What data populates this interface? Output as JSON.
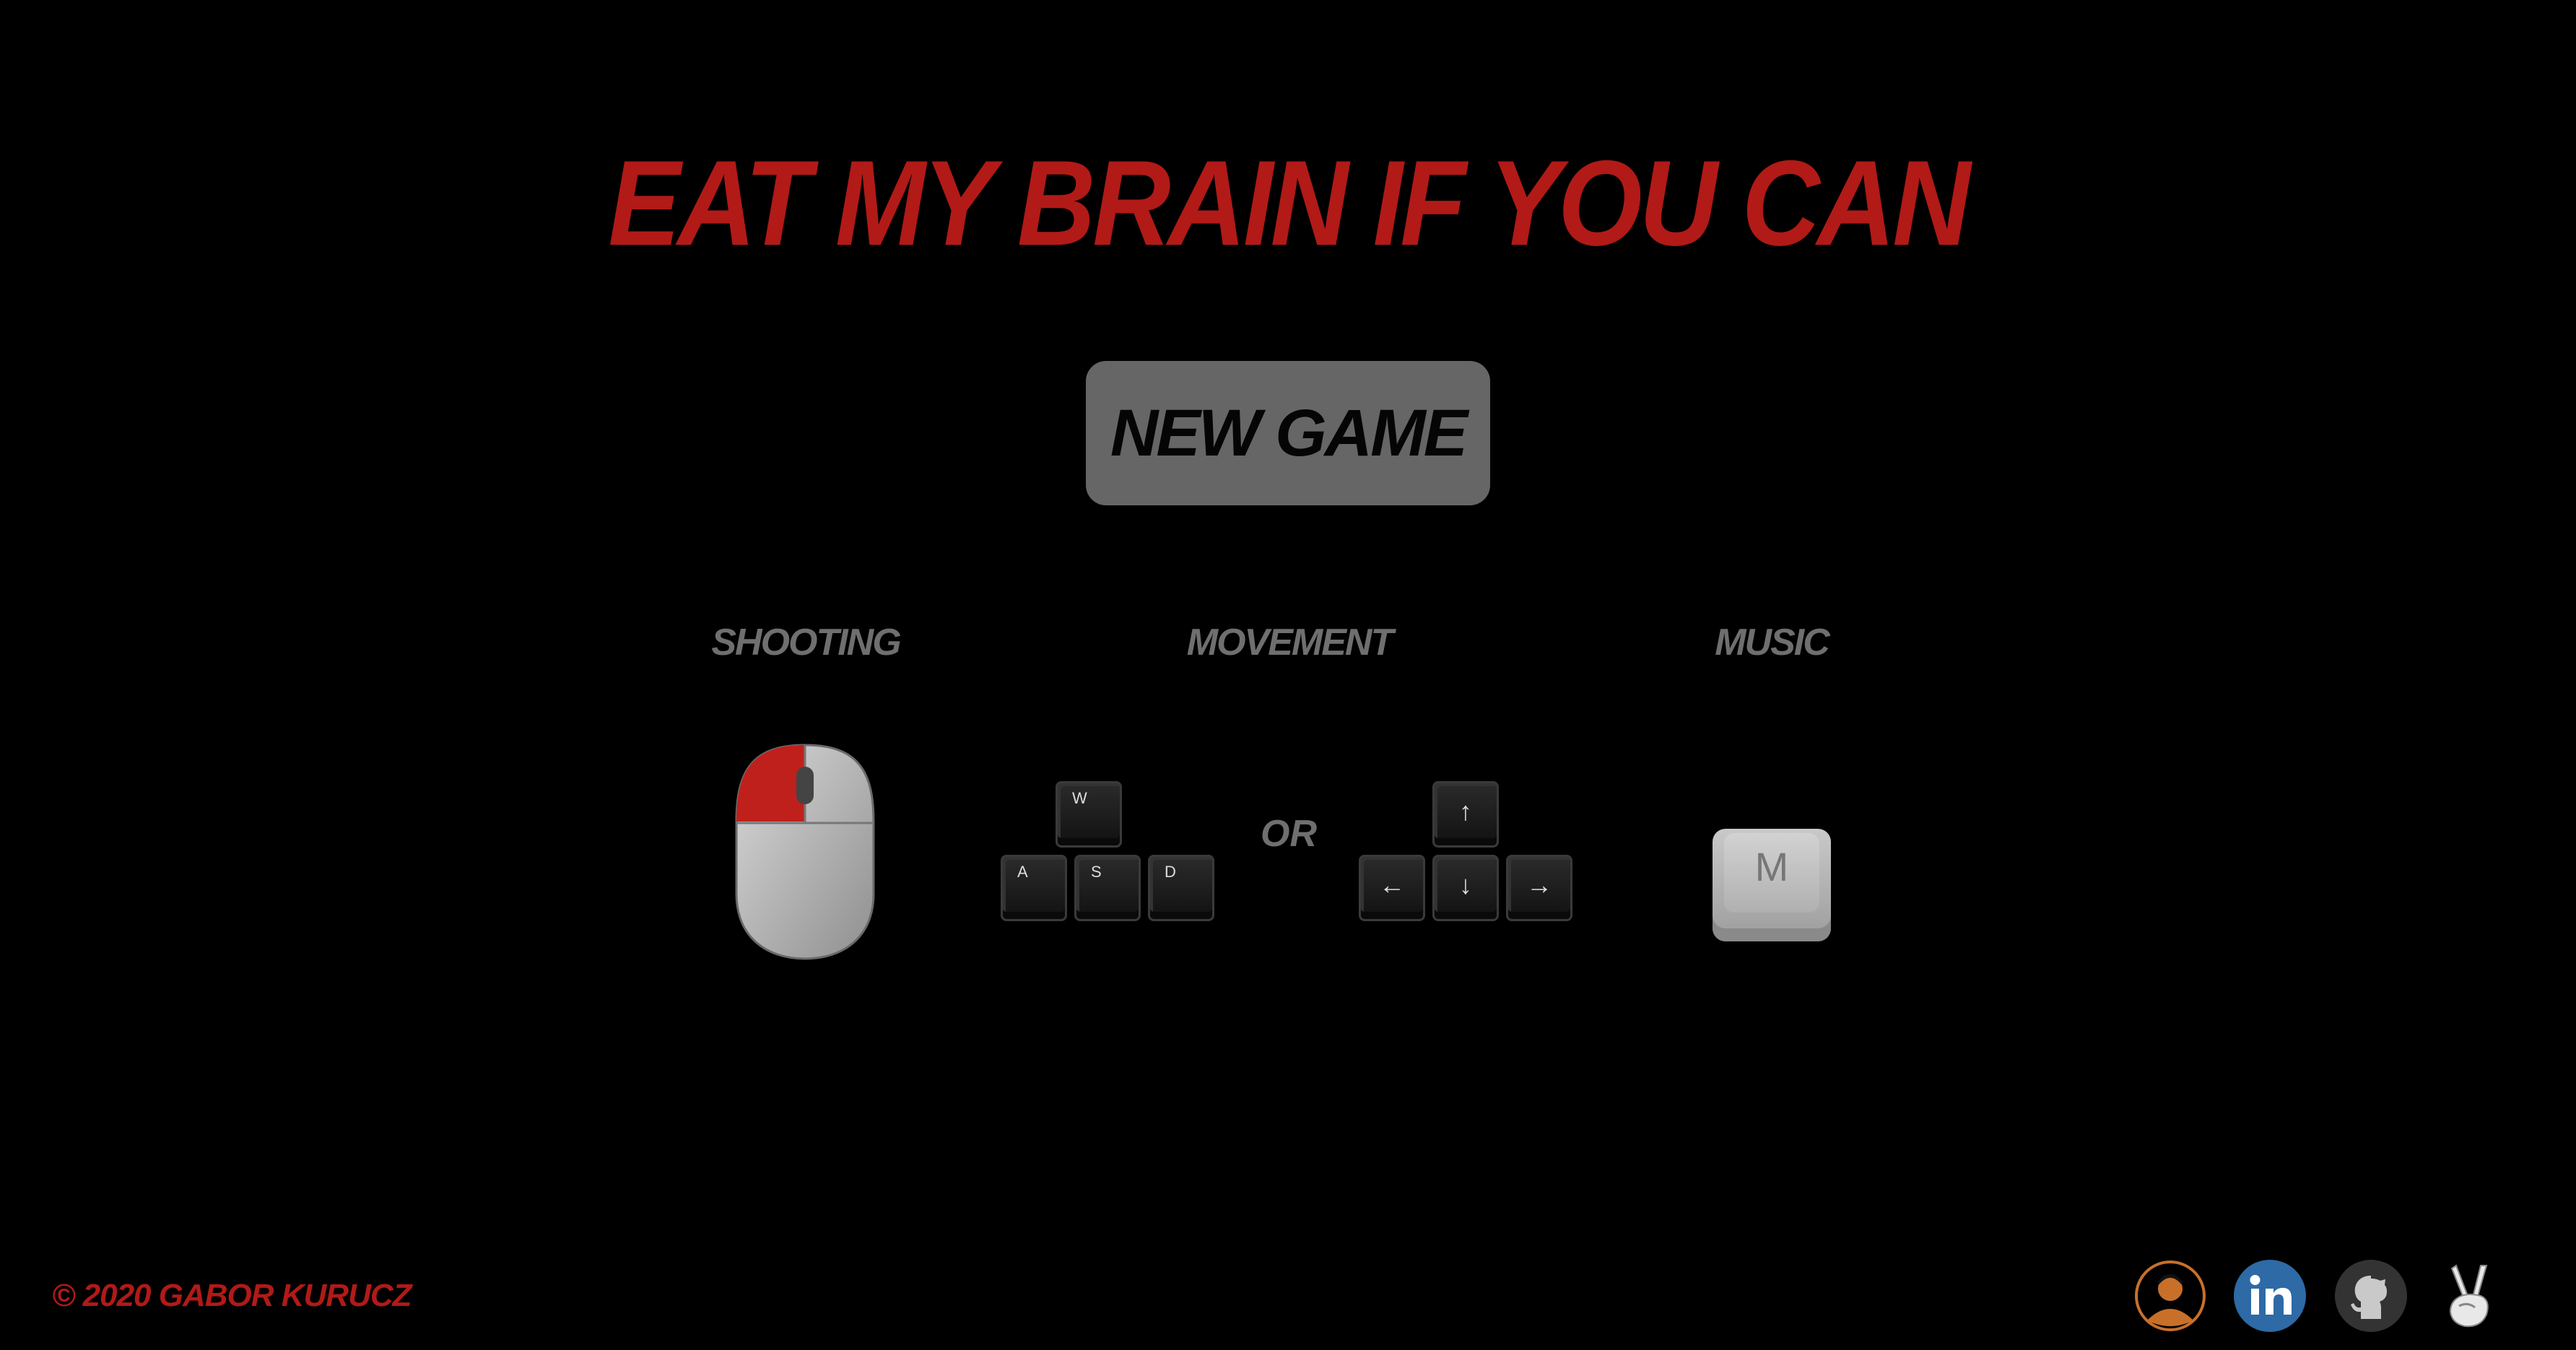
{
  "title": "EAT MY BRAIN IF YOU CAN",
  "new_game_label": "NEW GAME",
  "controls": {
    "shooting_label": "SHOOTING",
    "movement_label": "MOVEMENT",
    "music_label": "MUSIC",
    "or_label": "OR",
    "wasd_keys": [
      "W",
      "A",
      "S",
      "D"
    ],
    "arrow_keys": [
      "↑",
      "←",
      "↓",
      "→"
    ],
    "music_key": "M"
  },
  "footer": {
    "copyright": "© 2020 GABOR KURUCZ",
    "links": [
      "profile-icon",
      "linkedin-icon",
      "github-icon",
      "peace-hand-icon"
    ]
  },
  "colors": {
    "title_red": "#b11a17",
    "button_gray": "#666666",
    "label_gray": "#6f6f6f",
    "mouse_red": "#c0201c",
    "linkedin_blue": "#2d6aa6",
    "profile_orange": "#c8702a"
  }
}
